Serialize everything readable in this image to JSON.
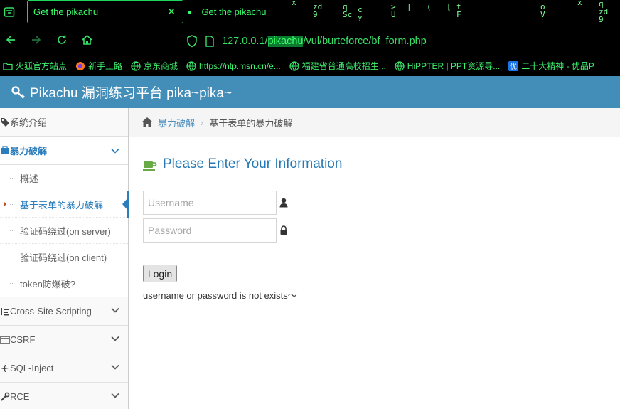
{
  "browser": {
    "tabs": [
      {
        "title": "Get the pikachu",
        "active": true
      },
      {
        "title": "Get the pikachu",
        "active": false
      }
    ],
    "tab_close": "✕",
    "url": {
      "host": "127.0.0.1/",
      "highlight": "pikachu",
      "path": "/vul/burteforce/bf_form.php"
    },
    "bookmarks": [
      {
        "label": "火狐官方站点",
        "icon": "folder-icon"
      },
      {
        "label": "新手上路",
        "icon": "firefox-icon"
      },
      {
        "label": "京东商城",
        "icon": "globe-icon"
      },
      {
        "label": "https://ntp.msn.cn/e...",
        "icon": "globe-icon"
      },
      {
        "label": "福建省普通高校招生...",
        "icon": "globe-icon"
      },
      {
        "label": "HiPPTER | PPT资源导...",
        "icon": "globe-icon"
      },
      {
        "label": "二十大精神 - 优品P",
        "icon": "you-icon"
      }
    ],
    "matrix_chars": [
      "x",
      "zd",
      "q",
      "c",
      "9",
      "Sc",
      "y",
      ">",
      "U",
      "|",
      "(",
      "[",
      "t",
      "F",
      "o",
      "V",
      "x",
      "q",
      "zd",
      "9"
    ]
  },
  "header": {
    "title": "Pikachu 漏洞练习平台 pika~pika~"
  },
  "sidebar": {
    "items": [
      {
        "label": "系统介绍"
      },
      {
        "label": "暴力破解",
        "open": true,
        "children": [
          {
            "label": "概述"
          },
          {
            "label": "基于表单的暴力破解",
            "active": true
          },
          {
            "label": "验证码绕过(on server)"
          },
          {
            "label": "验证码绕过(on client)"
          },
          {
            "label": "token防爆破?"
          }
        ]
      },
      {
        "label": "Cross-Site Scripting"
      },
      {
        "label": "CSRF"
      },
      {
        "label": "SQL-Inject"
      },
      {
        "label": "RCE"
      }
    ]
  },
  "breadcrumb": {
    "link": "暴力破解",
    "current": "基于表单的暴力破解"
  },
  "form": {
    "title": "Please Enter Your Information",
    "username_placeholder": "Username",
    "password_placeholder": "Password",
    "username_value": "",
    "password_value": "",
    "login_label": "Login",
    "message": "username or password is not exists～"
  },
  "colors": {
    "header_bg": "#438eb9",
    "accent": "#2b7dbc",
    "browser_text": "#39e067",
    "active_caret": "#c24d2b"
  }
}
